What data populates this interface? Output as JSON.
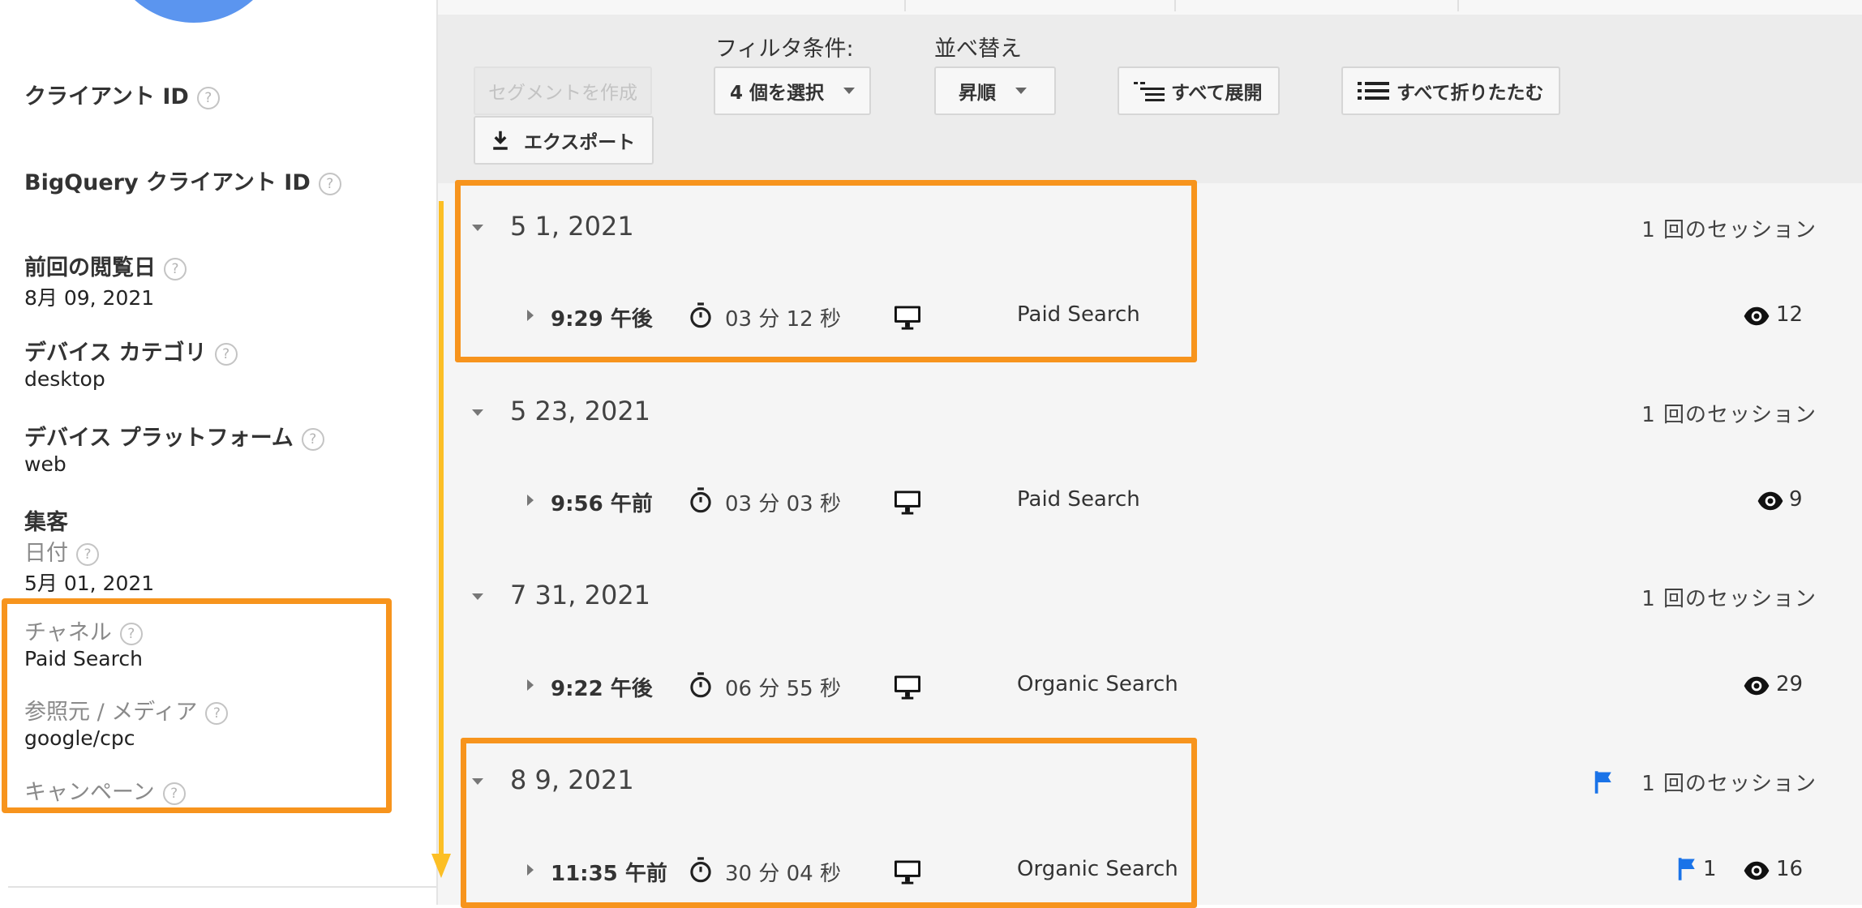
{
  "sidebar": {
    "client_id_label": "クライアント ID",
    "bigquery_id_label": "BigQuery クライアント ID",
    "last_visit_label": "前回の閲覧日",
    "last_visit_value": "8月 09, 2021",
    "device_category_label": "デバイス カテゴリ",
    "device_category_value": "desktop",
    "device_platform_label": "デバイス プラットフォーム",
    "device_platform_value": "web",
    "acquisition_label": "集客",
    "date_label": "日付",
    "date_value": "5月 01, 2021",
    "channel_label": "チャネル",
    "channel_value": "Paid Search",
    "source_medium_label": "参照元 / メディア",
    "source_medium_value": "google/cpc",
    "campaign_label": "キャンペーン",
    "help_glyph": "?"
  },
  "toolbar": {
    "filter_label": "フィルタ条件:",
    "sort_label": "並べ替え",
    "create_segment": "セグメントを作成",
    "export": "エクスポート",
    "filter_select": "4 個を選択",
    "sort_select": "昇順",
    "expand_all": "すべて展開",
    "collapse_all": "すべて折りたたむ"
  },
  "sessions": [
    {
      "date": "5 1, 2021",
      "count": "1 回のセッション",
      "time": "9:29 午後",
      "duration": "03 分 12 秒",
      "channel": "Paid Search",
      "views": "12"
    },
    {
      "date": "5 23, 2021",
      "count": "1 回のセッション",
      "time": "9:56 午前",
      "duration": "03 分 03 秒",
      "channel": "Paid Search",
      "views": "9"
    },
    {
      "date": "7 31, 2021",
      "count": "1 回のセッション",
      "time": "9:22 午後",
      "duration": "06 分 55 秒",
      "channel": "Organic Search",
      "views": "29"
    },
    {
      "date": "8 9, 2021",
      "count": "1 回のセッション",
      "time": "11:35 午前",
      "duration": "30 分 04 秒",
      "channel": "Organic Search",
      "views": "16",
      "goal_count": "1"
    }
  ],
  "colors": {
    "highlight": "#f7941d",
    "arrow": "#fcbf25",
    "flag": "#1a73e8",
    "avatar": "#5b95ef"
  },
  "icons": [
    "timer-icon",
    "desktop-icon",
    "eye-icon",
    "flag-icon",
    "download-icon",
    "expand-list-icon",
    "collapse-list-icon"
  ]
}
